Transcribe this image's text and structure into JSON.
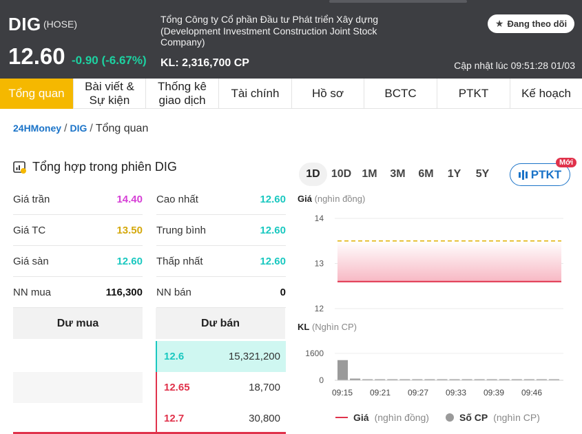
{
  "header": {
    "ticker": "DIG",
    "exchange": "(HOSE)",
    "price": "12.60",
    "change": "-0.90 (-6.67%)",
    "company_name": "Tổng Công ty Cổ phần Đầu tư Phát triển Xây dựng (Development Investment Construction Joint Stock Company)",
    "volume": "KL: 2,316,700 CP",
    "updated": "Cập nhật lúc 09:51:28 01/03",
    "follow_label": "Đang theo dõi"
  },
  "tabs": [
    {
      "label": "Tổng quan",
      "active": true
    },
    {
      "label": "Bài viết & Sự kiện"
    },
    {
      "label": "Thống kê giao dịch"
    },
    {
      "label": "Tài chính"
    },
    {
      "label": "Hồ sơ"
    },
    {
      "label": "BCTC"
    },
    {
      "label": "PTKT"
    },
    {
      "label": "Kế hoạch"
    }
  ],
  "breadcrumb": {
    "home": "24HMoney",
    "symbol": "DIG",
    "current": "Tổng quan"
  },
  "summary": {
    "title": "Tổng hợp trong phiên DIG",
    "rows": [
      [
        {
          "label": "Giá trần",
          "value": "14.40",
          "color": "#d63fd6"
        },
        {
          "label": "Cao nhất",
          "value": "12.60",
          "color": "#1ac8c0"
        }
      ],
      [
        {
          "label": "Giá TC",
          "value": "13.50",
          "color": "#d4a80c"
        },
        {
          "label": "Trung bình",
          "value": "12.60",
          "color": "#1ac8c0"
        }
      ],
      [
        {
          "label": "Giá sàn",
          "value": "12.60",
          "color": "#1ac8c0"
        },
        {
          "label": "Thấp nhất",
          "value": "12.60",
          "color": "#1ac8c0"
        }
      ],
      [
        {
          "label": "NN mua",
          "value": "116,300",
          "color": "#111111"
        },
        {
          "label": "NN bán",
          "value": "0",
          "color": "#111111"
        }
      ]
    ]
  },
  "orders": {
    "bid_header": "Dư mua",
    "ask_header": "Dư bán",
    "asks": [
      {
        "price": "12.6",
        "volume": "15,321,200",
        "color": "#1ac8c0"
      },
      {
        "price": "12.65",
        "volume": "18,700",
        "color": "#e0324b"
      },
      {
        "price": "12.7",
        "volume": "30,800",
        "color": "#e0324b"
      }
    ]
  },
  "ranges": [
    "1D",
    "10D",
    "1M",
    "3M",
    "6M",
    "1Y",
    "5Y"
  ],
  "ptkt_label": "PTKT",
  "new_badge": "Mới",
  "chart_data": [
    {
      "type": "line",
      "ylabel": "Giá",
      "yunit": "(nghìn đồng)",
      "ylim": [
        12,
        14
      ],
      "yticks": [
        "14",
        "13",
        "12"
      ],
      "reference_price": 13.5,
      "series": [
        {
          "name": "Giá",
          "values": [
            12.6,
            12.6
          ]
        }
      ],
      "grid": true
    },
    {
      "type": "bar",
      "ylabel": "KL",
      "yunit": "(Nghìn CP)",
      "ylim": [
        0,
        1600
      ],
      "yticks": [
        "1600",
        "0"
      ],
      "xticks": [
        "09:15",
        "09:21",
        "09:27",
        "09:33",
        "09:39",
        "09:46"
      ],
      "values": [
        1200,
        100,
        15,
        10,
        10,
        8,
        10,
        6,
        8,
        6,
        10,
        8,
        6,
        6,
        6,
        5,
        12,
        8
      ],
      "grid": true
    }
  ],
  "legend": {
    "price": "Giá",
    "price_unit": "(nghìn đồng)",
    "vol": "Số CP",
    "vol_unit": "(nghìn CP)"
  },
  "colors": {
    "header_bg": "#3d3e42",
    "accent": "#f5b800",
    "up": "#1dd1a1",
    "down": "#e0324b",
    "link": "#1a73c8"
  }
}
